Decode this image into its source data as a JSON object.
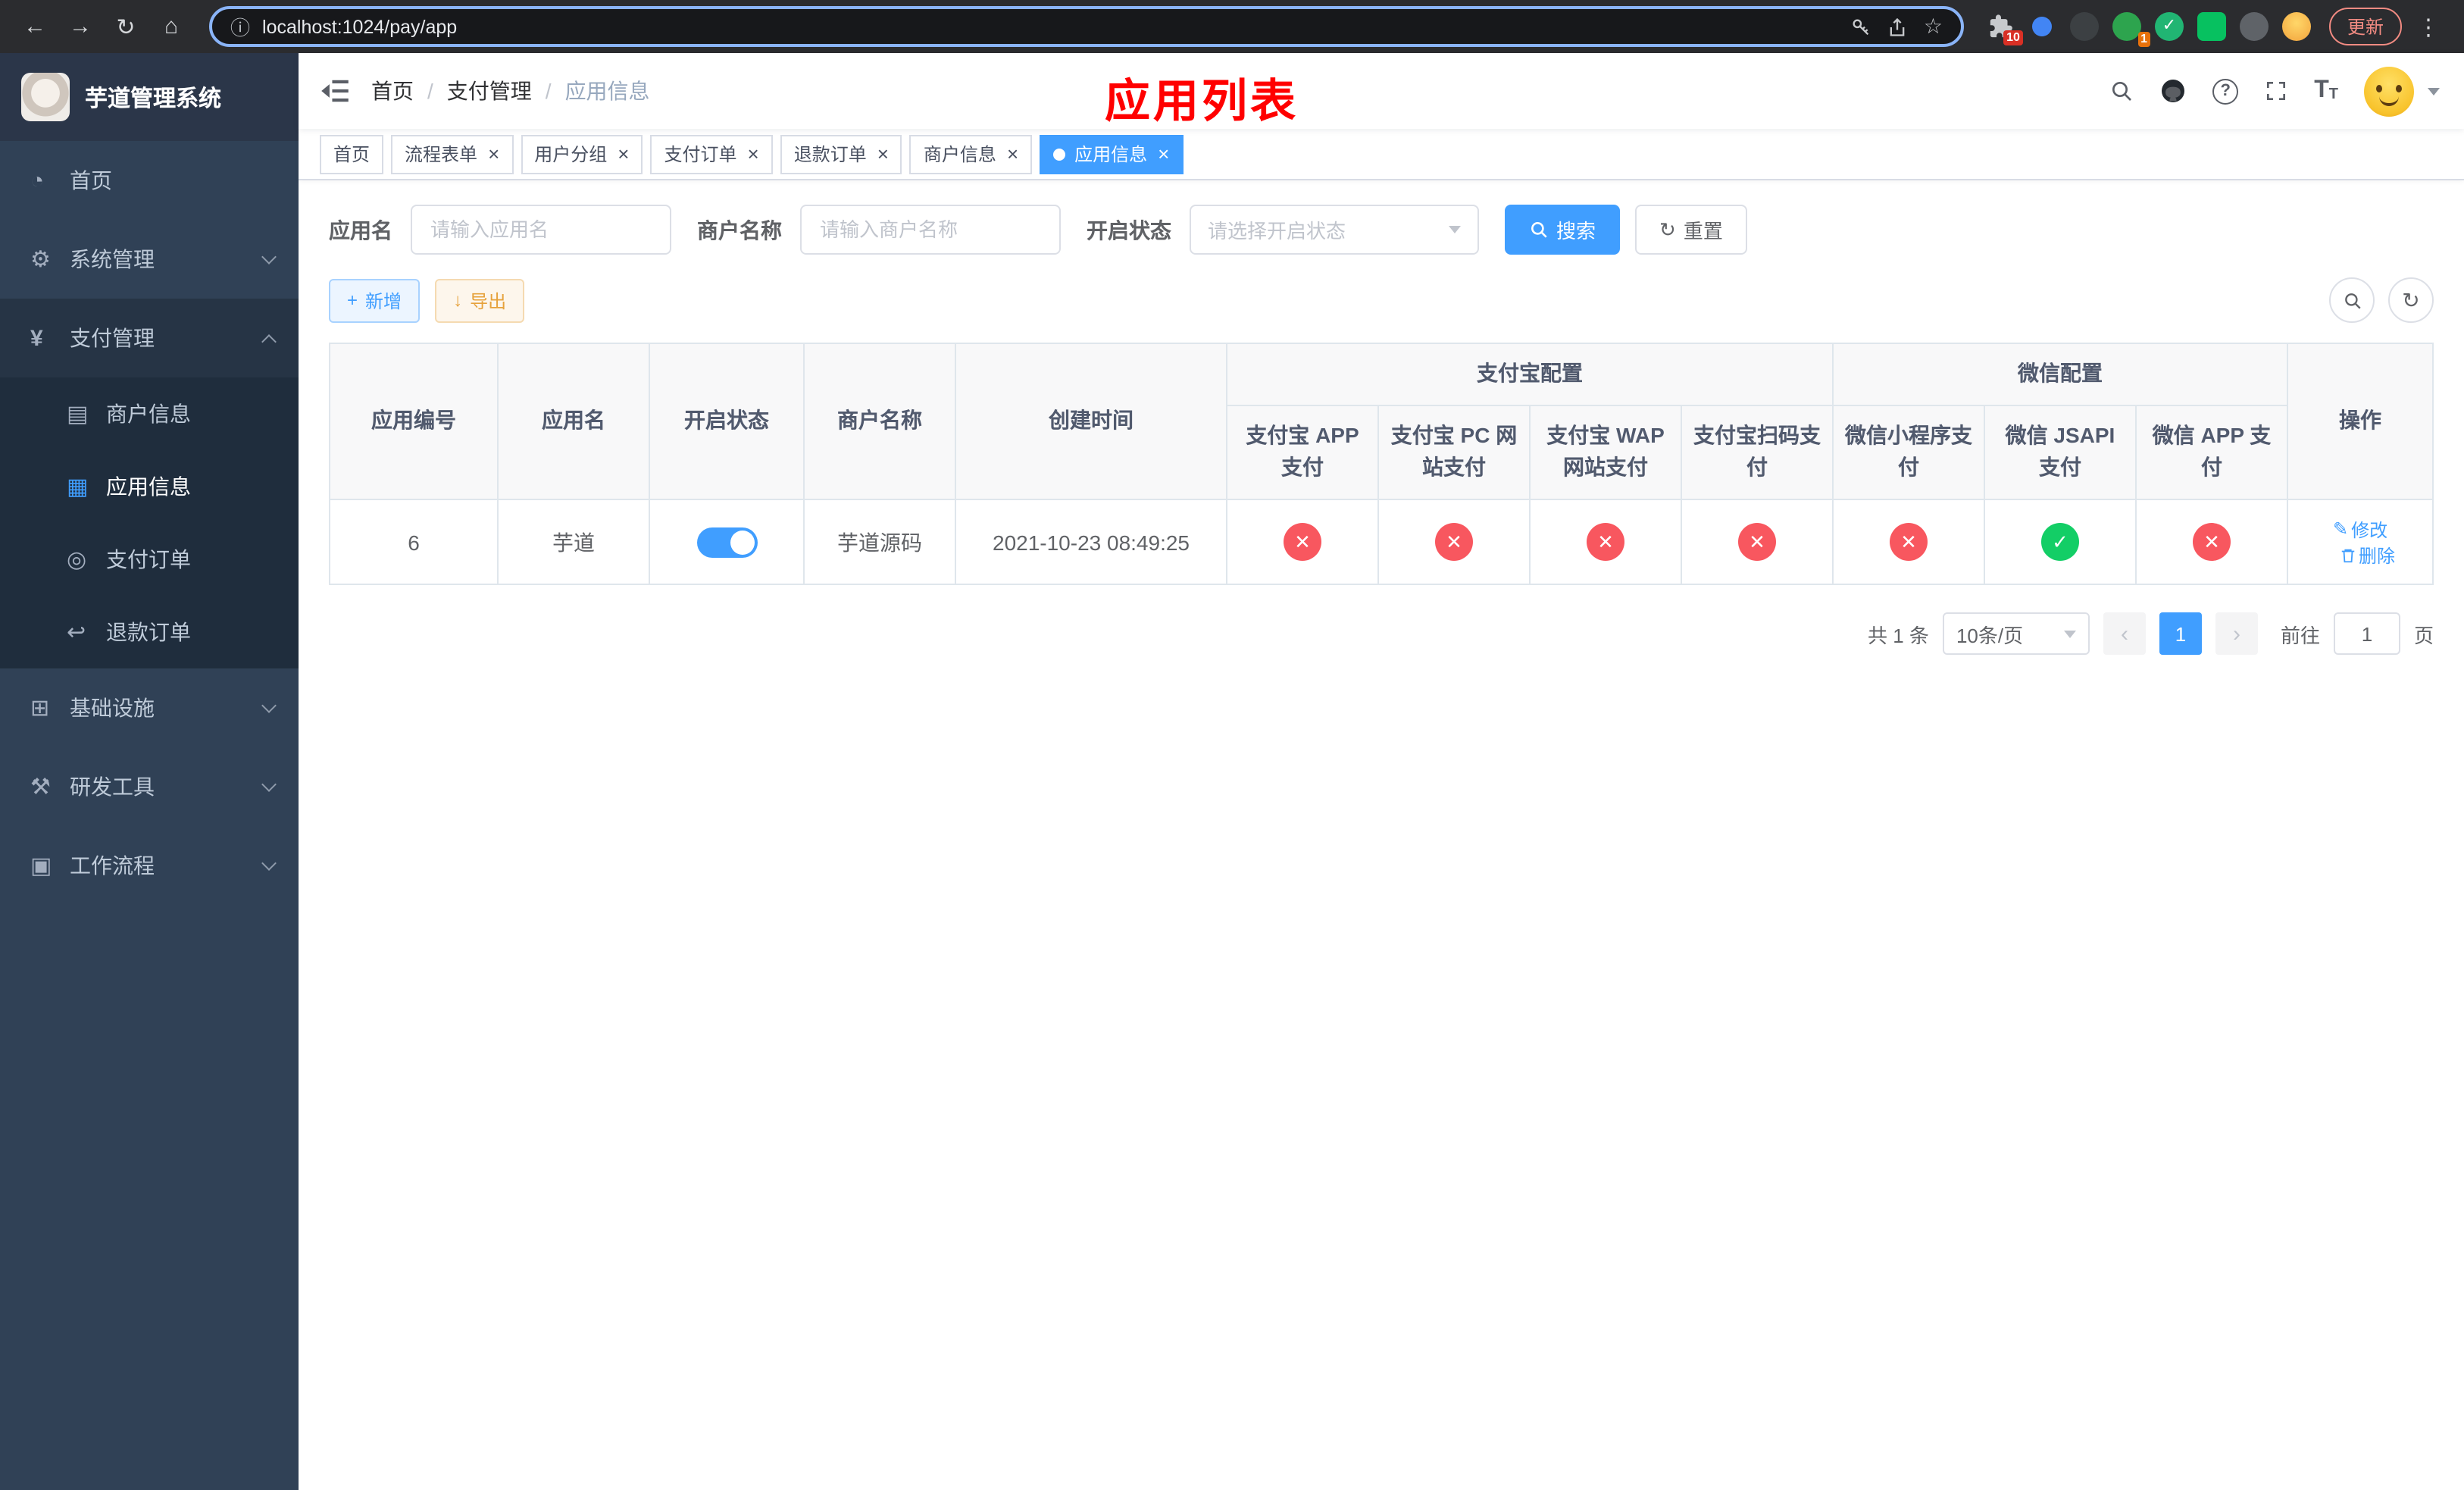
{
  "browser": {
    "url": "localhost:1024/pay/app",
    "update_label": "更新",
    "puzzle_badge": "10",
    "avatar_badge": "1"
  },
  "icons": {
    "back": "←",
    "forward": "→",
    "reload": "↻",
    "home": "⌂",
    "info": "ⓘ",
    "star": "☆",
    "kebab": "⋮",
    "close": "×",
    "dashboard": "◔",
    "gear": "⚙",
    "yen": "¥",
    "merchant_card": "▤",
    "app_grid": "▦",
    "pay_order": "◎",
    "refund": "↩",
    "infra": "⊞",
    "tools": "⚒",
    "workflow": "▣",
    "plus": "+",
    "download": "↓",
    "refresh": "↻",
    "edit": "✎",
    "check": "✓",
    "cross": "✕",
    "prev": "‹",
    "next": "›"
  },
  "sidebar": {
    "title": "芋道管理系统",
    "menu_home": "首页",
    "menu_system": "系统管理",
    "menu_pay": "支付管理",
    "menu_infra": "基础设施",
    "menu_dev": "研发工具",
    "menu_flow": "工作流程",
    "sub_merchant": "商户信息",
    "sub_app": "应用信息",
    "sub_pay_order": "支付订单",
    "sub_refund_order": "退款订单"
  },
  "header": {
    "breadcrumb": [
      "首页",
      "支付管理",
      "应用信息"
    ],
    "separator": "/",
    "page_title": "应用列表"
  },
  "tabs": [
    {
      "label": "首页"
    },
    {
      "label": "流程表单"
    },
    {
      "label": "用户分组"
    },
    {
      "label": "支付订单"
    },
    {
      "label": "退款订单"
    },
    {
      "label": "商户信息"
    },
    {
      "label": "应用信息"
    }
  ],
  "filters": {
    "app_name_label": "应用名",
    "app_name_placeholder": "请输入应用名",
    "merchant_label": "商户名称",
    "merchant_placeholder": "请输入商户名称",
    "status_label": "开启状态",
    "status_placeholder": "请选择开启状态",
    "search_label": "搜索",
    "reset_label": "重置"
  },
  "toolbar": {
    "add_label": "新增",
    "export_label": "导出"
  },
  "table": {
    "col_id": "应用编号",
    "col_name": "应用名",
    "col_status": "开启状态",
    "col_merchant": "商户名称",
    "col_created": "创建时间",
    "group_alipay": "支付宝配置",
    "group_wechat": "微信配置",
    "col_alipay_app": "支付宝 APP 支付",
    "col_alipay_pc": "支付宝 PC 网站支付",
    "col_alipay_wap": "支付宝 WAP 网站支付",
    "col_alipay_qr": "支付宝扫码支付",
    "col_wx_lite": "微信小程序支付",
    "col_wx_jsapi": "微信 JSAPI 支付",
    "col_wx_app": "微信 APP 支付",
    "col_action": "操作",
    "row": {
      "id": "6",
      "name": "芋道",
      "enabled": true,
      "merchant": "芋道源码",
      "created": "2021-10-23 08:49:25",
      "channels": [
        false,
        false,
        false,
        false,
        false,
        true,
        false
      ],
      "edit_label": "修改",
      "delete_label": "删除"
    }
  },
  "pagination": {
    "total": "共 1 条",
    "page_size": "10条/页",
    "page": "1",
    "goto_prefix": "前往",
    "goto_value": "1",
    "goto_suffix": "页"
  },
  "colors": {
    "primary": "#409eff",
    "success": "#13ce66",
    "danger": "#f8575f",
    "title_red": "#ff0000",
    "sidebar_bg": "#304156",
    "submenu_bg": "#1f2d3d"
  }
}
